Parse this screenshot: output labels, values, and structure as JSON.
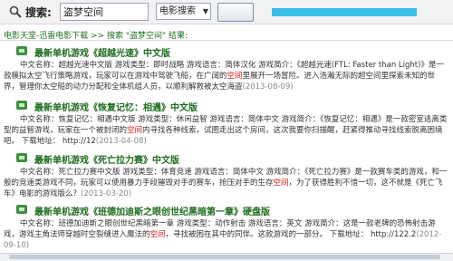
{
  "search": {
    "label": "搜索:",
    "query": "盗梦空间",
    "category": "电影搜索"
  },
  "breadcrumb": "电影天堂-迅雷电影下载 >> 搜索 \"盗梦空间\" 结果:",
  "results": [
    {
      "title": "最新单机游戏《超越光速》中文版",
      "desc_before": "中文名称：超越光速中文版 游戏类型：即时战略 游戏语言：简体汉化 游戏简介：《超越光速(FTL: Faster than Light)》是一款模拟太空飞行策略游戏，玩家可以在游戏中驾驶飞船，在广阔的",
      "highlight": "空间",
      "desc_after": "里展开一场冒险。进入浩瀚无际的超",
      "desc_end": "空间里探索未知的世界，管理你太空船的动力分配和全体机组人员，以顺利解救被太空海盗",
      "date": "(2013-08-09)"
    },
    {
      "title": "最新单机游戏《恢复记忆：相遇》中文版",
      "desc_before": "中文名称：恢复记忆：相遇中文版 游戏类型：休闲益智 游戏语言：简体中文 游戏简介：《恢复记忆：相遇》是一款密室逃离类型的益智游戏，玩家在一个被封闭的",
      "highlight": "空间",
      "desc_after": "内寻找各种线索，试图走出这个房间，这次我要你扫描醒，赶紧得推动寻找线索脱离困境吧。 下载地址： http://12",
      "desc_end": "",
      "date": "(2013-04-08)"
    },
    {
      "title": "最新单机游戏《死亡拉力赛》中文版",
      "desc_before": "中文名称：死亡拉力赛中文版 游戏类型：体育竞速 游戏语言：简体中文 游戏简介：《死亡拉力赛》是一款赛车类的游戏，和一般的竞速类游戏不同，玩家可以使用暴力手段摧毁对手的赛车，抢压对手的生存",
      "highlight": "空间",
      "desc_after": "，为了获得胜利不惜一切，这不就是《死亡飞车》电影的游戏版么？",
      "desc_end": "",
      "date": "(2013-03-20)"
    },
    {
      "title": "最新单机游戏《班德加迪斯之眼创世纪黑暗第一章》硬盘版",
      "desc_before": "中文名称：班德加迪斯之眼创世纪黑暗第一章 游戏类型：动作射击 游戏语言：英文 游戏简介：这是一款老牌的恐怖射击游戏，游戏主角法师穿越时空裂缝进入魔法的",
      "highlight": "空间",
      "desc_after": "，寻找被困在其中的同伴。这款游戏的一部分。 下载地址： http://12",
      "desc_end": "2.2",
      "date": "(2012-09-10)"
    }
  ],
  "colors": {
    "title_green": "#1e6b1e",
    "highlight_red": "#d11",
    "redaction_blue": "#39bfe6"
  }
}
